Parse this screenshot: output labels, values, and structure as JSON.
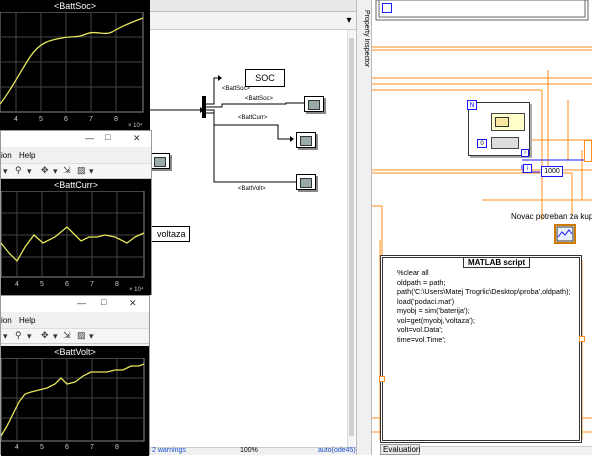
{
  "colors": {
    "plot_line": "#e6e65c",
    "plot_grid": "#555555",
    "lv_wire": "#ff8c1a",
    "lv_blue": "#1a1aff"
  },
  "fig_soc": {
    "title": "<BattSoc>",
    "x_ticks": [
      "4",
      "5",
      "6",
      "7",
      "8"
    ],
    "exp": "× 10⁴"
  },
  "fig_curr": {
    "window": {
      "menu": [
        "ion",
        "Help"
      ],
      "controls": [
        "—",
        "□",
        "✕"
      ]
    },
    "title": "<BattCurr>",
    "x_ticks": [
      "4",
      "5",
      "6",
      "7",
      "8"
    ],
    "exp": "× 10⁴"
  },
  "fig_volt": {
    "window": {
      "menu": [
        "ion",
        "Help"
      ],
      "controls": [
        "—",
        "□",
        "✕"
      ]
    },
    "title": "<BattVolt>",
    "x_ticks": [
      "4",
      "5",
      "6",
      "7",
      "8"
    ]
  },
  "simulink": {
    "soc_block": "SOC",
    "bus_label_soc1": "<BattSoc>",
    "bus_label_soc2": "<BattSoc>",
    "bus_label_curr": "<BattCurr>",
    "bus_label_volt": "<BattVolt>",
    "voltaza_block": "voltaza",
    "status": {
      "warnings": "2 warnings",
      "zoom": "100%",
      "solver": "auto(ode45)"
    },
    "property_inspector": "Property Inspector",
    "dropdown_arrow": "▾"
  },
  "labview": {
    "num_1000": "1000",
    "novac_label": "Novac potreban za kupnj",
    "script_title": "MATLAB script",
    "script_lines": [
      "%clear all",
      "oldpath = path;",
      "path('C:\\Users\\Matej Trogrlic\\Desktop\\proba',oldpath);",
      "load('podaci.mat')",
      "myobj = sim('baterija');",
      "vol=get(myobj,'voltaza');",
      "volt=vol.Data';",
      "time=vol.Time';"
    ],
    "evaluation_tab": "Evaluation",
    "const_zero": "0",
    "small_n": "N",
    "small_i": "i"
  }
}
